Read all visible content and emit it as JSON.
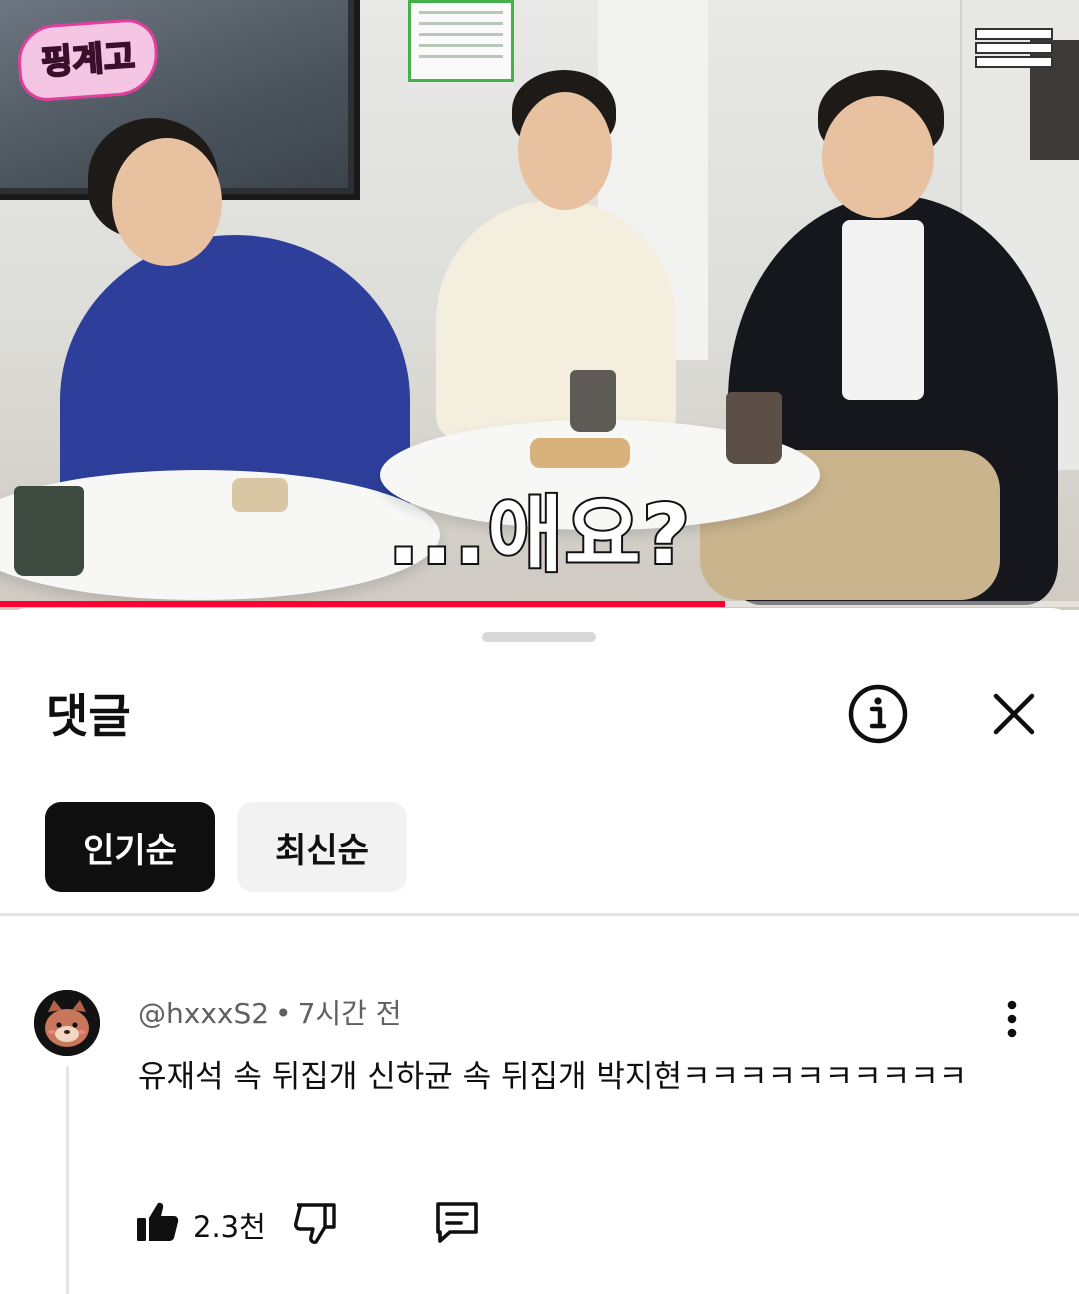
{
  "video": {
    "channel_logo_text": "핑계고",
    "subtitle": "...애요?",
    "progress_fraction": 0.672,
    "accent_color": "#ff0033"
  },
  "comments_panel": {
    "title": "댓글",
    "info_icon": "info-icon",
    "close_icon": "close-icon",
    "sort_chips": [
      {
        "label": "인기순",
        "selected": true
      },
      {
        "label": "최신순",
        "selected": false
      }
    ]
  },
  "comments": [
    {
      "author": "@hxxxS2",
      "separator": "•",
      "time": "7시간 전",
      "text": "유재석 속 뒤집개 신하균 속 뒤집개 박지현ㅋㅋㅋㅋㅋㅋㅋㅋㅋㅋ",
      "likes": "2.3천",
      "like_icon": "thumbs-up-icon",
      "dislike_icon": "thumbs-down-icon",
      "reply_icon": "reply-icon",
      "menu_icon": "more-vert-icon"
    }
  ]
}
